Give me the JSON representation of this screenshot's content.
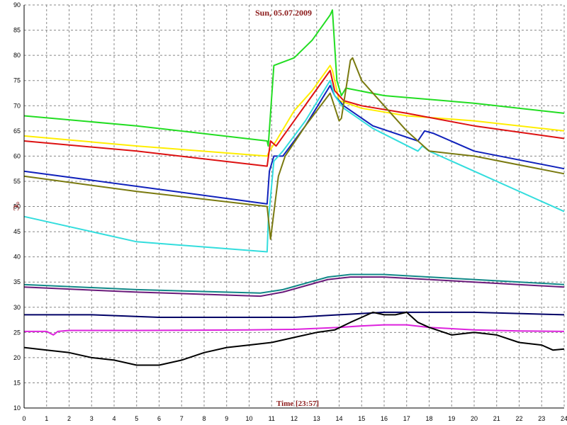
{
  "chart_data": {
    "type": "line",
    "title": "Sun, 05.07.2009",
    "xlabel": "Time [23:57]",
    "ylabel": "°C",
    "xlim": [
      0,
      24
    ],
    "ylim": [
      10,
      90
    ],
    "x_ticks": [
      0,
      1,
      2,
      3,
      4,
      5,
      6,
      7,
      8,
      9,
      10,
      11,
      12,
      13,
      14,
      15,
      16,
      17,
      18,
      19,
      20,
      21,
      22,
      23,
      24
    ],
    "y_ticks": [
      10,
      15,
      20,
      25,
      30,
      35,
      40,
      45,
      50,
      55,
      60,
      65,
      70,
      75,
      80,
      85,
      90
    ],
    "grid": true,
    "series": [
      {
        "color": "#22dd22",
        "x": [
          0,
          5,
          10.8,
          10.85,
          11.1,
          12.0,
          12.8,
          13.6,
          13.7,
          13.9,
          14.1,
          14.3,
          16,
          20,
          24
        ],
        "y": [
          68,
          66,
          63,
          62,
          78,
          79.5,
          83,
          88,
          89,
          75,
          72,
          73.5,
          72,
          70.5,
          68.5
        ]
      },
      {
        "color": "#ffee00",
        "x": [
          0,
          5,
          10.8,
          10.9,
          11.2,
          12.0,
          12.8,
          13.6,
          13.7,
          14.0,
          15,
          17,
          20,
          24
        ],
        "y": [
          64,
          62,
          60,
          61,
          63,
          69,
          73,
          78,
          77,
          71,
          69.5,
          68,
          67,
          65
        ]
      },
      {
        "color": "#dd1111",
        "x": [
          0,
          5,
          10.8,
          10.95,
          11.2,
          12.0,
          12.8,
          13.6,
          13.8,
          14.2,
          15,
          17,
          20,
          24
        ],
        "y": [
          63,
          61,
          58,
          63,
          62,
          67,
          72,
          77,
          73,
          71,
          70,
          68.5,
          66,
          63.5
        ]
      },
      {
        "color": "#1122bb",
        "x": [
          0,
          5,
          10.8,
          10.9,
          11.1,
          11.5,
          12.5,
          13.6,
          13.8,
          14.2,
          15.5,
          17.5,
          17.8,
          18.2,
          20,
          24
        ],
        "y": [
          57,
          54,
          50.5,
          57,
          60,
          60,
          66,
          74,
          72,
          70,
          66,
          63,
          65,
          64.5,
          61,
          57.5
        ]
      },
      {
        "color": "#33dddd",
        "x": [
          0,
          5,
          10.8,
          10.85,
          11.1,
          11.5,
          12.5,
          13.6,
          13.8,
          14.2,
          15.5,
          17.5,
          17.7,
          18,
          20,
          24
        ],
        "y": [
          48,
          43,
          41,
          47,
          59,
          61,
          67,
          75,
          72,
          69.5,
          65.5,
          61,
          62,
          61,
          57,
          49
        ]
      },
      {
        "color": "#7a7a10",
        "x": [
          0,
          5,
          10.8,
          10.95,
          11.3,
          11.6,
          12.5,
          13.6,
          14.0,
          14.1,
          14.5,
          14.6,
          15.0,
          16.0,
          17.0,
          18.0,
          20,
          24
        ],
        "y": [
          56,
          53,
          50,
          43.5,
          56,
          60,
          66,
          72.5,
          67,
          67.5,
          79,
          79.5,
          75,
          70,
          65,
          61,
          60,
          56.5
        ]
      },
      {
        "color": "#118888",
        "x": [
          0,
          5,
          10.5,
          11.5,
          13.5,
          14.5,
          16,
          18,
          20,
          24
        ],
        "y": [
          34.5,
          33.5,
          32.8,
          33.5,
          36,
          36.5,
          36.5,
          36,
          35.5,
          34.5
        ]
      },
      {
        "color": "#6a1a7a",
        "x": [
          0,
          5,
          10.5,
          11.5,
          13.5,
          14.5,
          16,
          18,
          20,
          24
        ],
        "y": [
          34,
          33,
          32.2,
          33,
          35.5,
          36,
          36,
          35.5,
          35,
          34
        ]
      },
      {
        "color": "#000066",
        "x": [
          0,
          3,
          6,
          9,
          12,
          14,
          16,
          18,
          20,
          24
        ],
        "y": [
          28.5,
          28.5,
          28,
          28,
          28,
          28.5,
          29,
          29,
          29,
          28.5
        ]
      },
      {
        "color": "#dd22dd",
        "x": [
          0,
          1,
          1.3,
          1.5,
          2,
          5,
          10,
          12,
          14,
          15,
          16,
          17,
          18,
          20,
          22,
          24
        ],
        "y": [
          25.2,
          25.2,
          24.5,
          25.2,
          25.4,
          25.4,
          25.5,
          25.6,
          26,
          26.3,
          26.5,
          26.5,
          26,
          25.5,
          25.3,
          25.2
        ]
      },
      {
        "color": "#000000",
        "x": [
          0,
          1,
          2,
          3,
          4,
          5,
          6,
          7,
          8,
          9,
          10,
          11,
          12,
          13,
          13.8,
          14.5,
          15,
          15.5,
          16,
          16.5,
          17,
          17.5,
          18,
          19,
          20,
          21,
          22,
          23,
          23.5,
          24
        ],
        "y": [
          22,
          21.5,
          21,
          20,
          19.5,
          18.5,
          18.5,
          19.5,
          21,
          22,
          22.5,
          23,
          24,
          25,
          25.5,
          27,
          28,
          29,
          28.5,
          28.5,
          29,
          27,
          26,
          24.5,
          25,
          24.5,
          23,
          22.5,
          21.5,
          21.7
        ]
      }
    ]
  }
}
